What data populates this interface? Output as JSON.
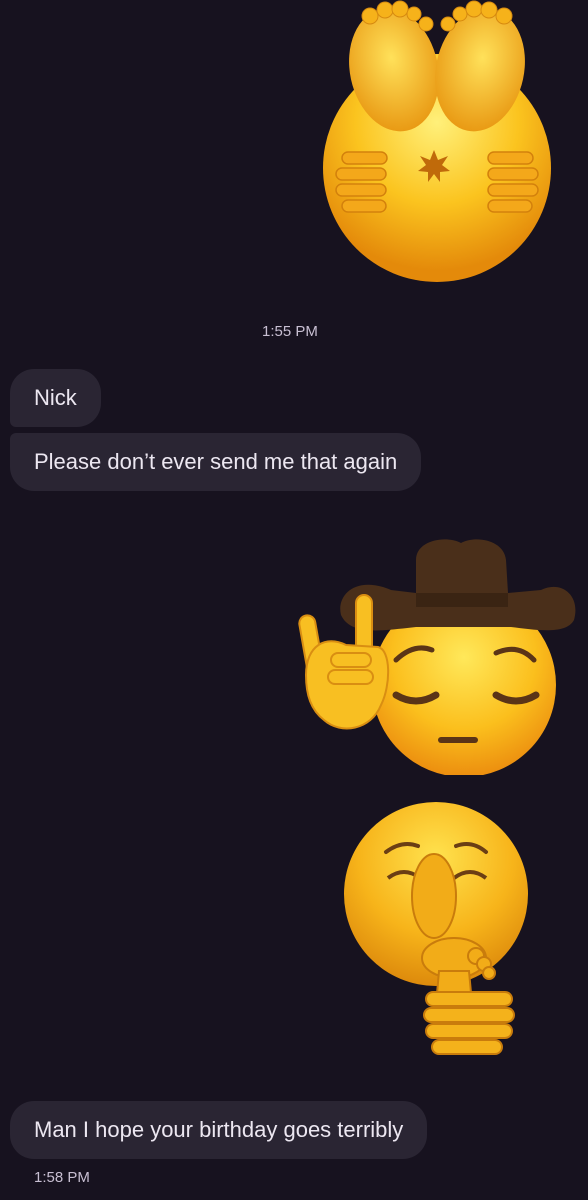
{
  "conversation": {
    "timestamps": {
      "first": "1:55 PM",
      "second": "1:58 PM"
    },
    "received_messages": [
      {
        "text": "Nick"
      },
      {
        "text": "Please don’t ever send me that again"
      },
      {
        "text": "Man I hope your birthday goes terribly"
      }
    ],
    "sent_stickers": [
      {
        "icon": "feet-up-face-emoji-icon"
      },
      {
        "icon": "cowboy-pensive-rock-hand-emoji-icon"
      },
      {
        "icon": "pleading-face-biting-foot-emoji-icon"
      }
    ]
  },
  "colors": {
    "background": "#17121f",
    "bubble": "#2a2533",
    "text": "#ece7f1",
    "timestamp": "#c8bfd2",
    "emoji_yellow": "#f9b91f"
  }
}
